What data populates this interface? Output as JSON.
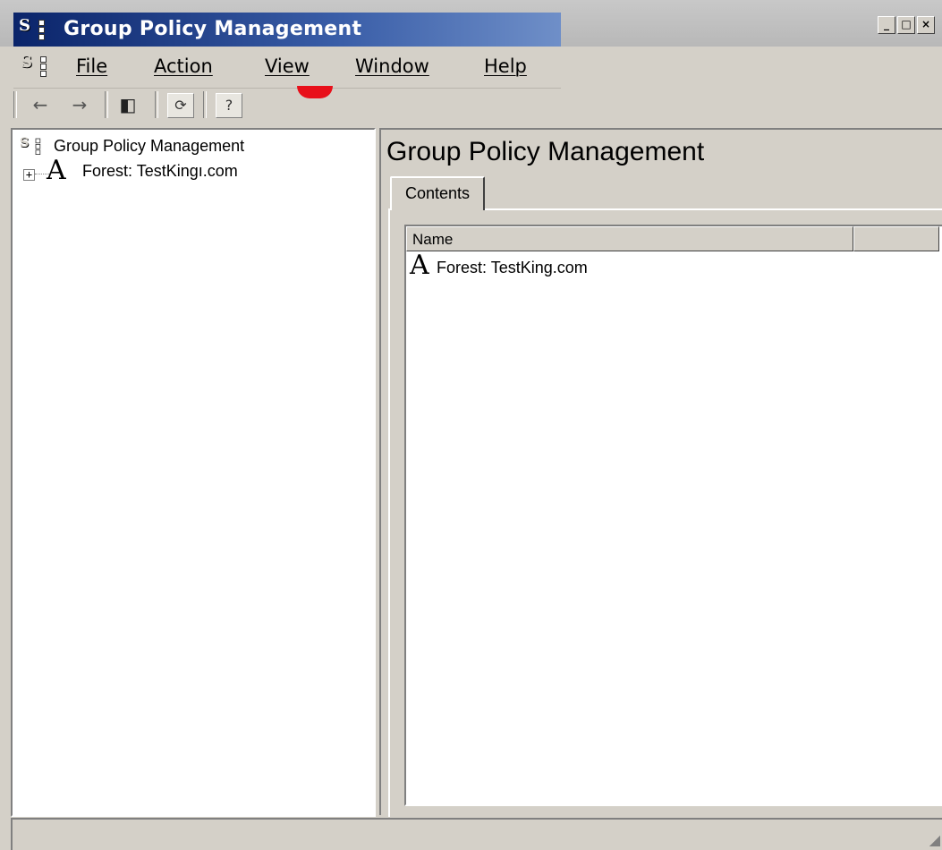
{
  "window": {
    "title": "Group Policy Management",
    "controls": {
      "minimize": "_",
      "maximize": "□",
      "close": "×"
    }
  },
  "menu": {
    "items": [
      {
        "label": "File"
      },
      {
        "label": "Action"
      },
      {
        "label": "View"
      },
      {
        "label": "Window"
      },
      {
        "label": "Help"
      }
    ]
  },
  "toolbar": {
    "buttons": [
      {
        "icon": "back-arrow-icon",
        "glyph": "←"
      },
      {
        "icon": "forward-arrow-icon",
        "glyph": "→"
      },
      {
        "icon": "show-hide-tree-icon",
        "glyph": "◧"
      },
      {
        "icon": "refresh-icon",
        "glyph": "⟳"
      },
      {
        "icon": "help-icon",
        "glyph": "?"
      }
    ]
  },
  "tree": {
    "root_label": "Group Policy Management",
    "forest_label": "Forest: TestKingı.com",
    "expander": "+"
  },
  "details": {
    "title": "Group Policy Management",
    "tab_label": "Contents",
    "column_name": "Name",
    "rows": [
      {
        "label": "Forest: TestKing.com"
      }
    ]
  }
}
